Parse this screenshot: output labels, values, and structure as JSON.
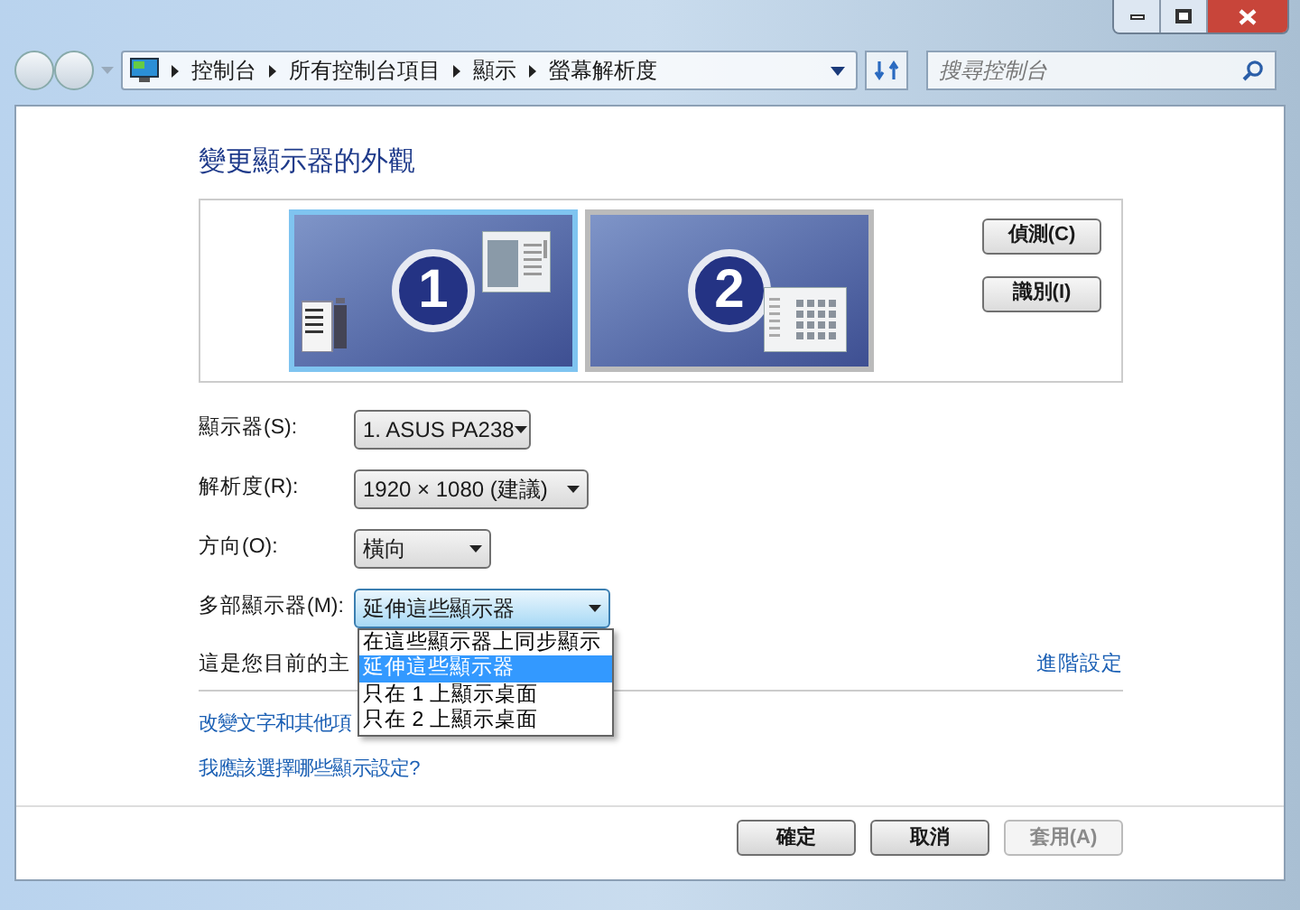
{
  "breadcrumb": [
    "控制台",
    "所有控制台項目",
    "顯示",
    "螢幕解析度"
  ],
  "search": {
    "placeholder": "搜尋控制台"
  },
  "heading": "變更顯示器的外觀",
  "monitors": [
    {
      "label": "1",
      "selected": true
    },
    {
      "label": "2",
      "selected": false
    }
  ],
  "side_buttons": [
    "偵測(C)",
    "識別(I)"
  ],
  "settings": [
    {
      "label": "顯示器(S):",
      "value": "1. ASUS PA238",
      "expanded": false
    },
    {
      "label": "解析度(R):",
      "value": "1920 × 1080 (建議)",
      "expanded": false
    },
    {
      "label": "方向(O):",
      "value": "橫向",
      "expanded": false
    },
    {
      "label": "多部顯示器(M):",
      "value": "延伸這些顯示器",
      "expanded": true,
      "options": [
        {
          "label": "在這些顯示器上同步顯示",
          "selected": false
        },
        {
          "label": "延伸這些顯示器",
          "selected": true
        },
        {
          "label": "只在 1 上顯示桌面",
          "selected": false
        },
        {
          "label": "只在 2 上顯示桌面",
          "selected": false
        }
      ]
    }
  ],
  "primary_note": "這是您目前的主",
  "advanced_link": "進階設定",
  "links": [
    "改變文字和其他項",
    "我應該選擇哪些顯示設定?"
  ],
  "footer_buttons": [
    {
      "label": "確定",
      "disabled": false
    },
    {
      "label": "取消",
      "disabled": false
    },
    {
      "label": "套用(A)",
      "disabled": true
    }
  ]
}
